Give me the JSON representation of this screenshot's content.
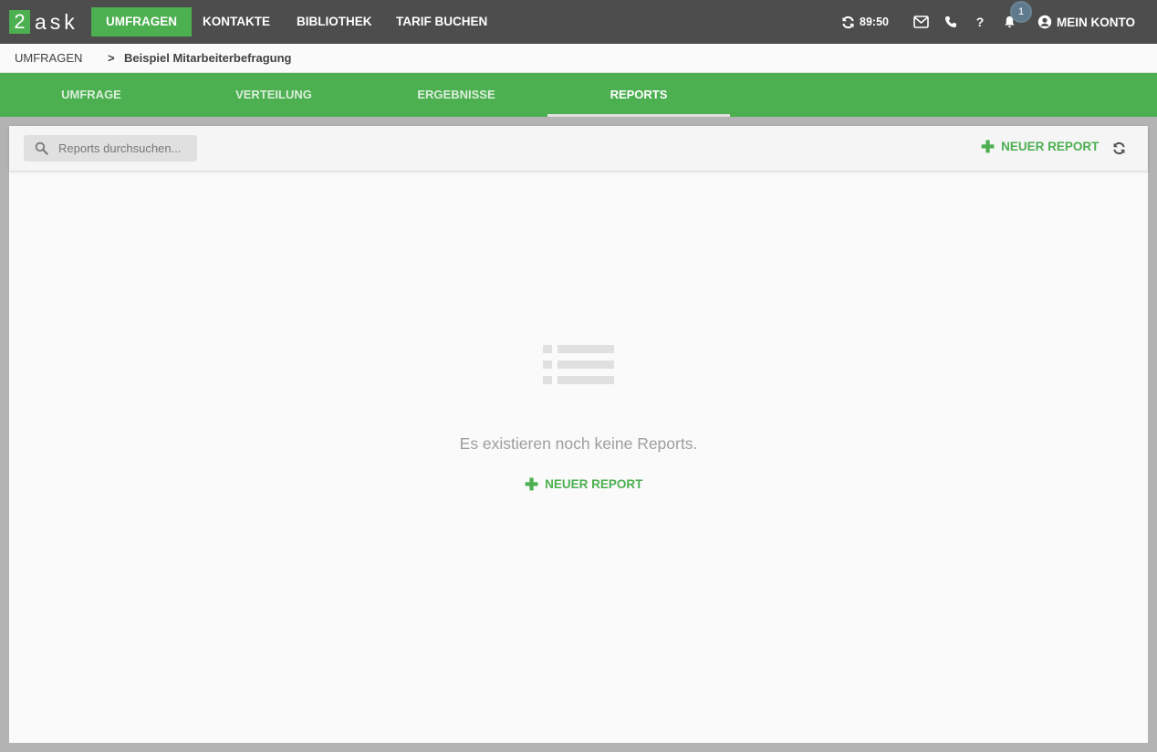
{
  "logo": {
    "digit": "2",
    "text": "ask"
  },
  "nav": {
    "items": [
      {
        "label": "UMFRAGEN"
      },
      {
        "label": "KONTAKTE"
      },
      {
        "label": "BIBLIOTHEK"
      },
      {
        "label": "TARIF BUCHEN"
      }
    ],
    "timer": "89:50",
    "notification_count": "1",
    "account_label": "MEIN KONTO"
  },
  "breadcrumb": {
    "root": "UMFRAGEN",
    "separator": ">",
    "current": "Beispiel Mitarbeiterbefragung"
  },
  "tabs": [
    {
      "label": "UMFRAGE"
    },
    {
      "label": "VERTEILUNG"
    },
    {
      "label": "ERGEBNISSE"
    },
    {
      "label": "REPORTS"
    }
  ],
  "toolbar": {
    "search_placeholder": "Reports durchsuchen...",
    "new_report_label": "NEUER REPORT"
  },
  "empty_state": {
    "message": "Es existieren noch keine Reports.",
    "new_report_label": "NEUER REPORT"
  },
  "colors": {
    "brand_green": "#4caf50",
    "topbar": "#4d4d4d",
    "background": "#b3b3b3"
  }
}
